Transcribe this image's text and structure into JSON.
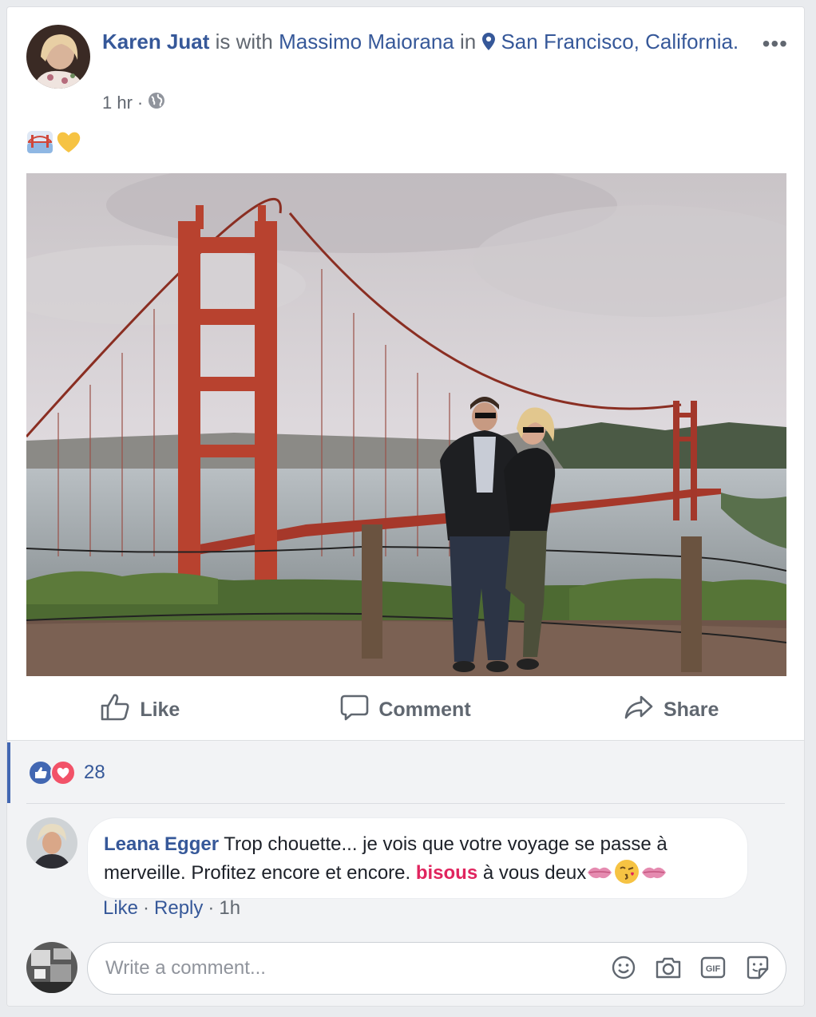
{
  "post": {
    "author": "Karen Juat",
    "is_with_text": "is with",
    "tagged": "Massimo Maiorana",
    "in_text": "in",
    "location": "San Francisco, California.",
    "time": "1 hr",
    "dot": "·",
    "more_label": "•••",
    "emojis": [
      "bridge-emoji",
      "yellow-heart-emoji"
    ]
  },
  "actions": {
    "like": "Like",
    "comment": "Comment",
    "share": "Share"
  },
  "reactions": {
    "count": "28",
    "types": [
      "like",
      "love"
    ]
  },
  "comment": {
    "author": "Leana Egger",
    "text_before": " Trop chouette... je vois que votre voyage se passe à merveille. Profitez encore et encore. ",
    "highlight": "bisous",
    "text_after": " à vous deux",
    "like": "Like",
    "dot1": "·",
    "reply": "Reply",
    "dot2": "·",
    "time": "1h"
  },
  "composer": {
    "placeholder": "Write a comment...",
    "tools": [
      "smiley-icon",
      "camera-icon",
      "gif-icon",
      "sticker-icon"
    ],
    "gif_label": "GIF"
  },
  "colors": {
    "link": "#365899",
    "secondary": "#616770",
    "highlight": "#e0245e",
    "like_blue": "#4267b2",
    "love_red": "#f25268"
  }
}
